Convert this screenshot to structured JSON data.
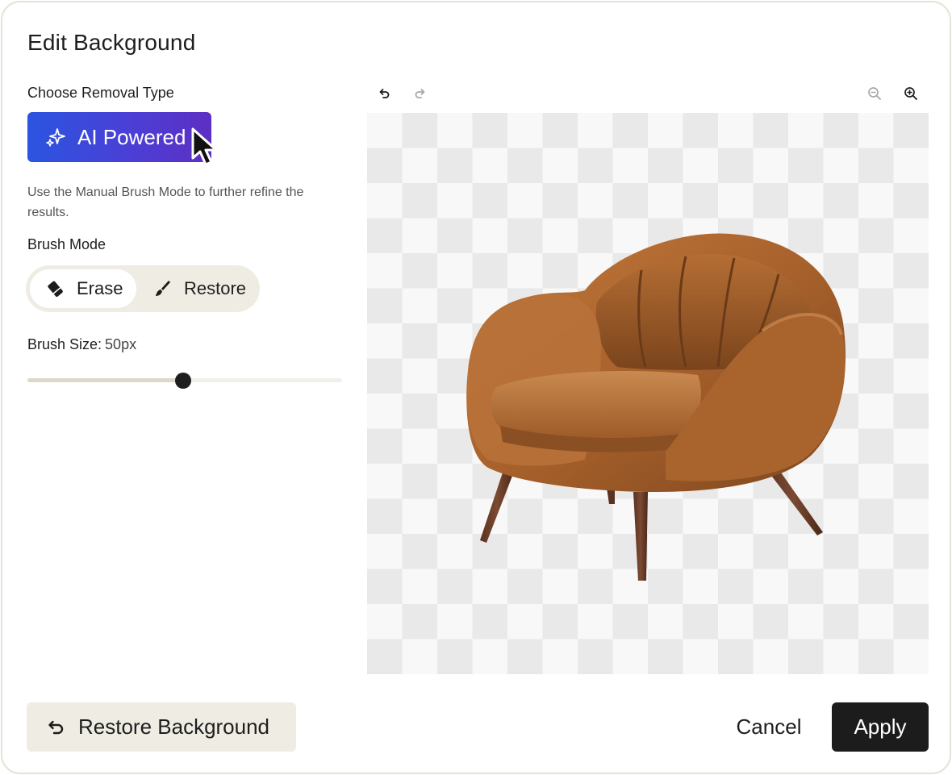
{
  "dialog": {
    "title": "Edit Background"
  },
  "removal": {
    "label": "Choose Removal Type",
    "ai_button_label": "AI Powered",
    "ai_icon": "sparkles-icon"
  },
  "hint": "Use the Manual Brush Mode to further refine the results.",
  "brush_mode": {
    "label": "Brush Mode",
    "selected": "Erase",
    "options": [
      {
        "label": "Erase",
        "icon": "eraser-icon"
      },
      {
        "label": "Restore",
        "icon": "brush-icon"
      }
    ]
  },
  "brush_size": {
    "label": "Brush Size:",
    "value": "50px",
    "level_fraction": 0.495
  },
  "toolbar": {
    "undo_icon": "undo-icon",
    "redo_icon": "redo-icon",
    "zoom_out_icon": "zoom-out-icon",
    "zoom_in_icon": "zoom-in-icon"
  },
  "canvas": {
    "content": "armchair-image",
    "background": "transparency-checkerboard"
  },
  "footer": {
    "restore_background_label": "Restore Background",
    "cancel_label": "Cancel",
    "apply_label": "Apply"
  },
  "colors": {
    "ai_gradient_start": "#2a55e0",
    "ai_gradient_end": "#5d2fc3",
    "apply_bg": "#1c1c1c",
    "pill_bg": "#efece4",
    "border": "#e6e2d6"
  }
}
